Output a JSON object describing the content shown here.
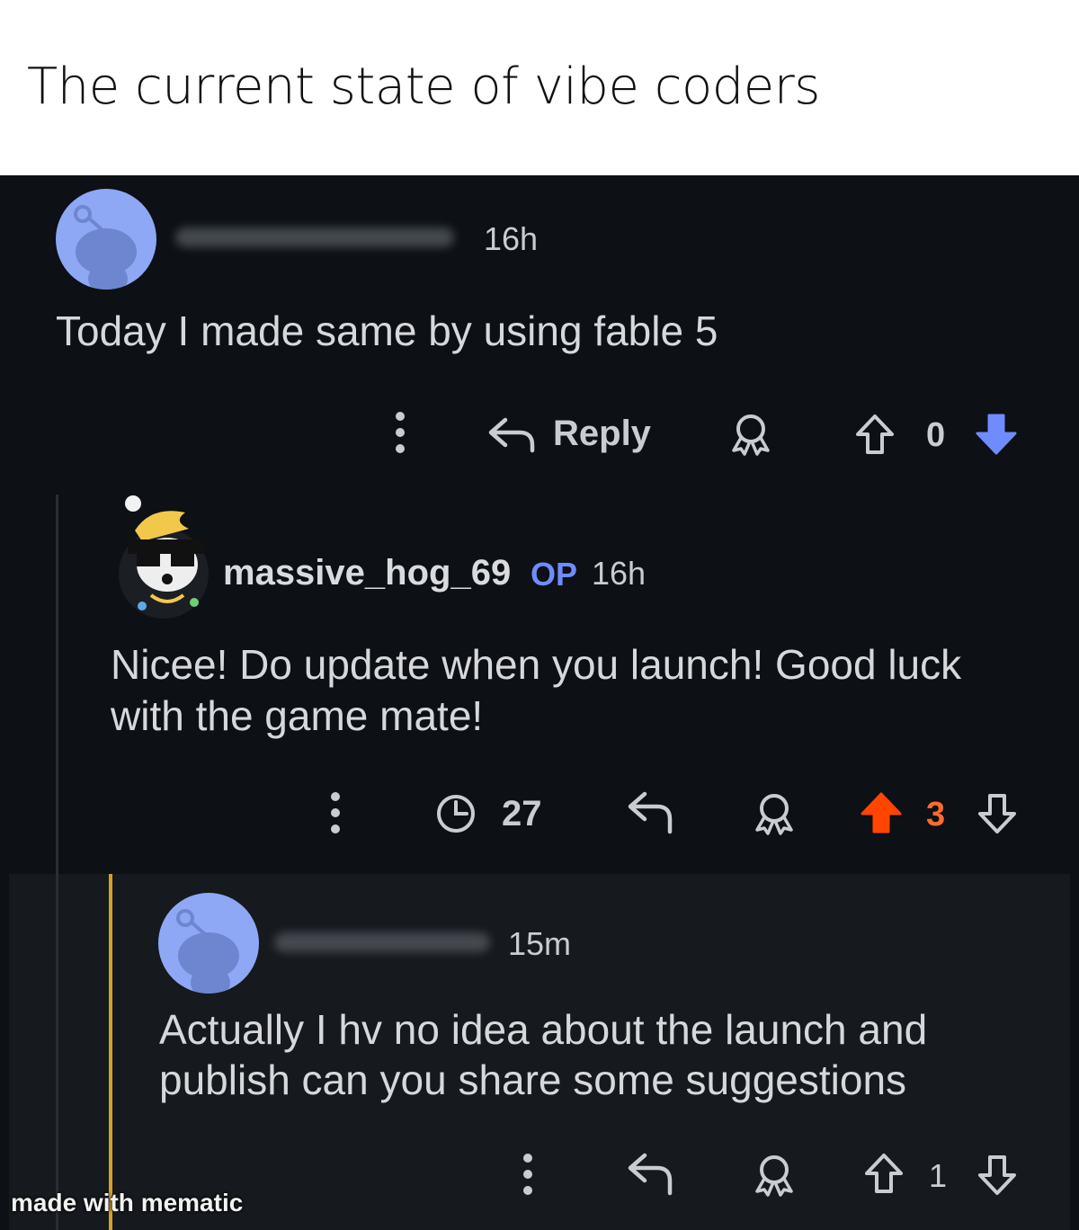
{
  "caption": {
    "text": "The current state of vibe coders"
  },
  "comments": [
    {
      "time": "16h",
      "body": "Today I made same by using fable 5",
      "reply_label": "Reply",
      "vote_count": "0"
    },
    {
      "username": "massive_hog_69",
      "op_badge": "OP",
      "time": "16h",
      "body_line1": "Nicee! Do update when you launch! Good luck",
      "body_line2": "with the game mate!",
      "timer_count": "27",
      "vote_count": "3"
    },
    {
      "time": "15m",
      "body_line1": "Actually I hv no idea about the launch and",
      "body_line2": "publish can you share some suggestions",
      "vote_count": "1"
    }
  ],
  "watermark": "made with mematic",
  "colors": {
    "background": "#0d1014",
    "upvoted": "#ff4500",
    "downvoted": "#6f8cff",
    "op": "#6f8cff",
    "thread_highlight": "#d1a12a"
  }
}
